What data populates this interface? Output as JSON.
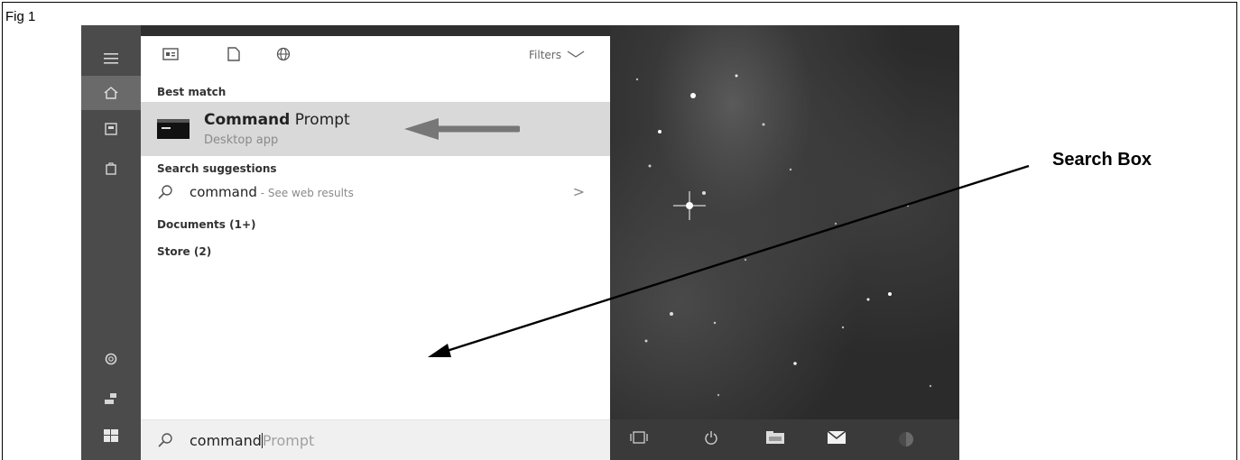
{
  "figure": {
    "label": "Fig 1",
    "callout": "Search Box"
  },
  "start_menu": {
    "rail_icons": [
      "hamburger-icon",
      "home-icon",
      "documents-icon",
      "store-icon",
      "settings-icon",
      "power-icon",
      "windows-icon"
    ],
    "toolbar": {
      "icons": [
        "apps-icon",
        "document-icon",
        "web-icon"
      ],
      "filters_label": "Filters"
    },
    "best_match": {
      "header": "Best match",
      "title_bold": "Command",
      "title_rest": " Prompt",
      "subtitle": "Desktop app"
    },
    "search_suggestions": {
      "header": "Search suggestions",
      "query": "command",
      "hint": " - See web results",
      "arrow": ">"
    },
    "documents_header": "Documents (1+)",
    "store_header": "Store (2)",
    "search_box": {
      "typed": "command",
      "autocomplete": "Prompt"
    }
  },
  "taskbar": {
    "icons": [
      "task-view-icon",
      "power-icon",
      "file-explorer-icon",
      "mail-icon",
      "cortana-icon"
    ]
  },
  "colors": {
    "rail": "#4b4b4b",
    "highlight": "#d9d9d9",
    "desktop": "#2b2b2b",
    "taskbar": "#3a3a3a"
  }
}
